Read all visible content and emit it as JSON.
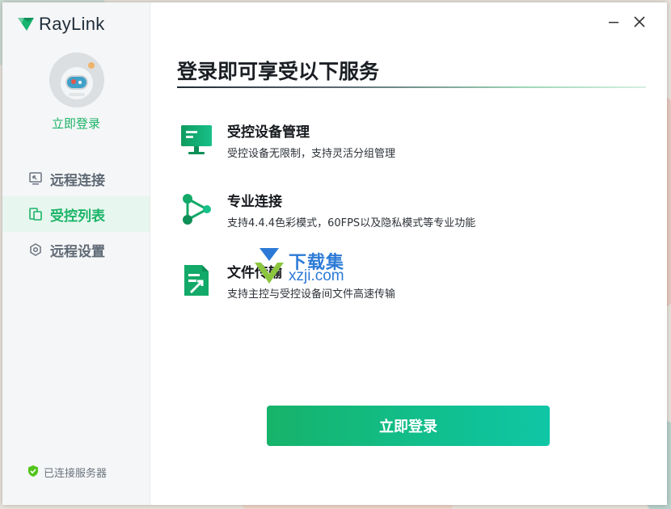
{
  "app": {
    "name": "RayLink"
  },
  "window_controls": {
    "minimize": "minimize",
    "close": "close"
  },
  "sidebar": {
    "login_link": "立即登录",
    "nav": [
      {
        "label": "远程连接",
        "icon": "remote-connect-icon",
        "active": false
      },
      {
        "label": "受控列表",
        "icon": "controlled-list-icon",
        "active": true
      },
      {
        "label": "远程设置",
        "icon": "settings-hex-icon",
        "active": false
      }
    ],
    "status": {
      "text": "已连接服务器",
      "icon": "shield-check-icon",
      "color": "#52c41a"
    }
  },
  "main": {
    "title": "登录即可享受以下服务",
    "features": [
      {
        "title": "受控设备管理",
        "desc": "受控设备无限制，支持灵活分组管理",
        "icon": "monitor-icon"
      },
      {
        "title": "专业连接",
        "desc": "支持4.4.4色彩模式，60FPS以及隐私模式等专业功能",
        "icon": "share-nodes-icon"
      },
      {
        "title": "文件传输",
        "desc": "支持主控与受控设备间文件高速传输",
        "icon": "file-transfer-icon"
      }
    ],
    "cta_label": "立即登录"
  },
  "watermark": {
    "cn": "下载集",
    "en": "xzji.com"
  },
  "colors": {
    "accent": "#1bb468",
    "accent_dark": "#0e9f6e",
    "cta_end": "#0fc6a6",
    "title": "#1b1f24"
  }
}
